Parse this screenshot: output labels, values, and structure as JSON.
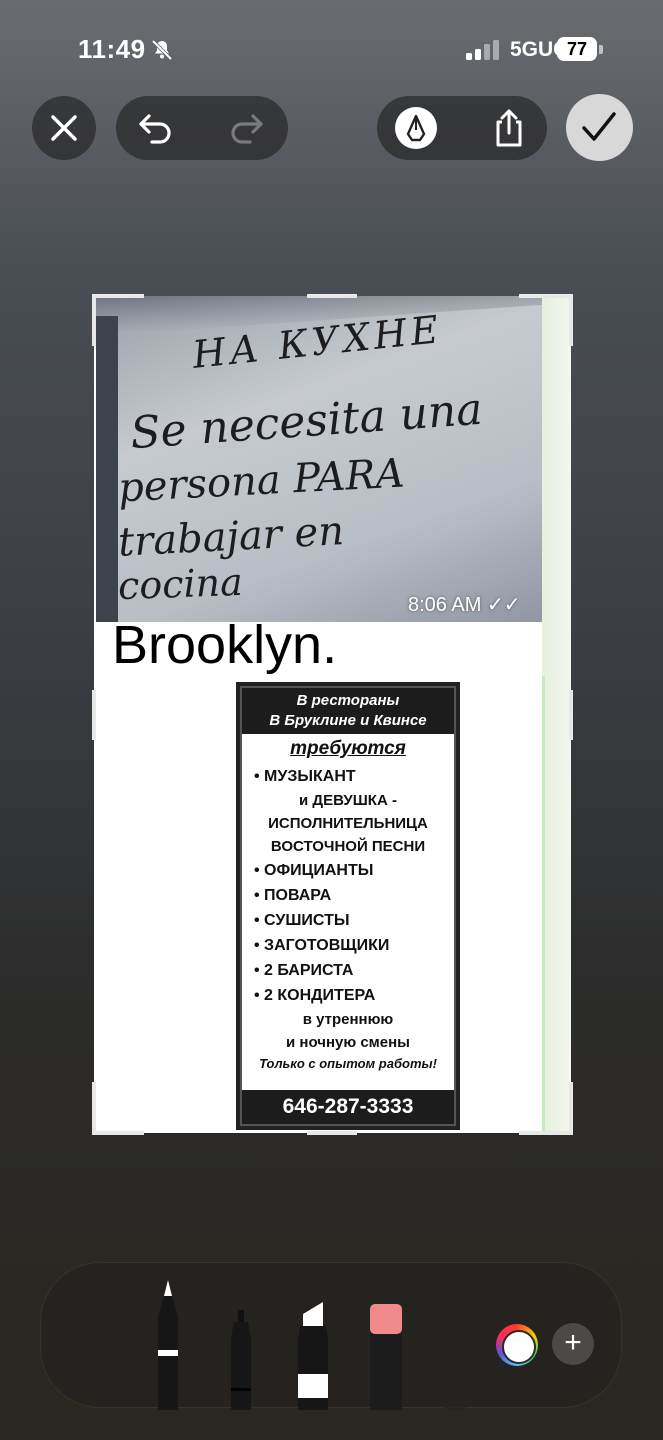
{
  "status_bar": {
    "time": "11:49",
    "network": "5GUC",
    "battery": "77"
  },
  "toolbar": {
    "close_icon": "close-icon",
    "undo_icon": "undo-icon",
    "redo_icon": "redo-icon",
    "markup_icon": "pen-tip-icon",
    "share_icon": "share-icon",
    "done_icon": "checkmark-icon"
  },
  "image": {
    "photo_lines": [
      "НА КУХНЕ",
      "Se necesita una",
      "persona PARA",
      "trabajar en",
      "cocina"
    ],
    "timestamp": "8:06 AM",
    "caption": "Brooklyn.",
    "ad": {
      "header_lines": [
        "В рестораны",
        "В Бруклине и Квинсе"
      ],
      "subheader": "требуются",
      "items": [
        "• МУЗЫКАНТ",
        "и ДЕВУШКА -",
        "ИСПОЛНИТЕЛЬНИЦА",
        "ВОСТОЧНОЙ ПЕСНИ",
        "• ОФИЦИАНТЫ",
        "• ПОВАРА",
        "• СУШИСТЫ",
        "• ЗАГОТОВЩИКИ",
        "• 2 БАРИСТА",
        "• 2 КОНДИТЕРА",
        "в утреннюю",
        "и ночную смены"
      ],
      "note": "Только с опытом работы!",
      "phone": "646-287-3333"
    }
  },
  "palette": {
    "tools": [
      "pen",
      "fineliner",
      "marker",
      "eraser",
      "pencil"
    ],
    "color_label": "color-picker",
    "add_label": "+"
  },
  "colors": {
    "accent_done": "#d8d8d8",
    "eraser_pink": "#f08a8a"
  }
}
